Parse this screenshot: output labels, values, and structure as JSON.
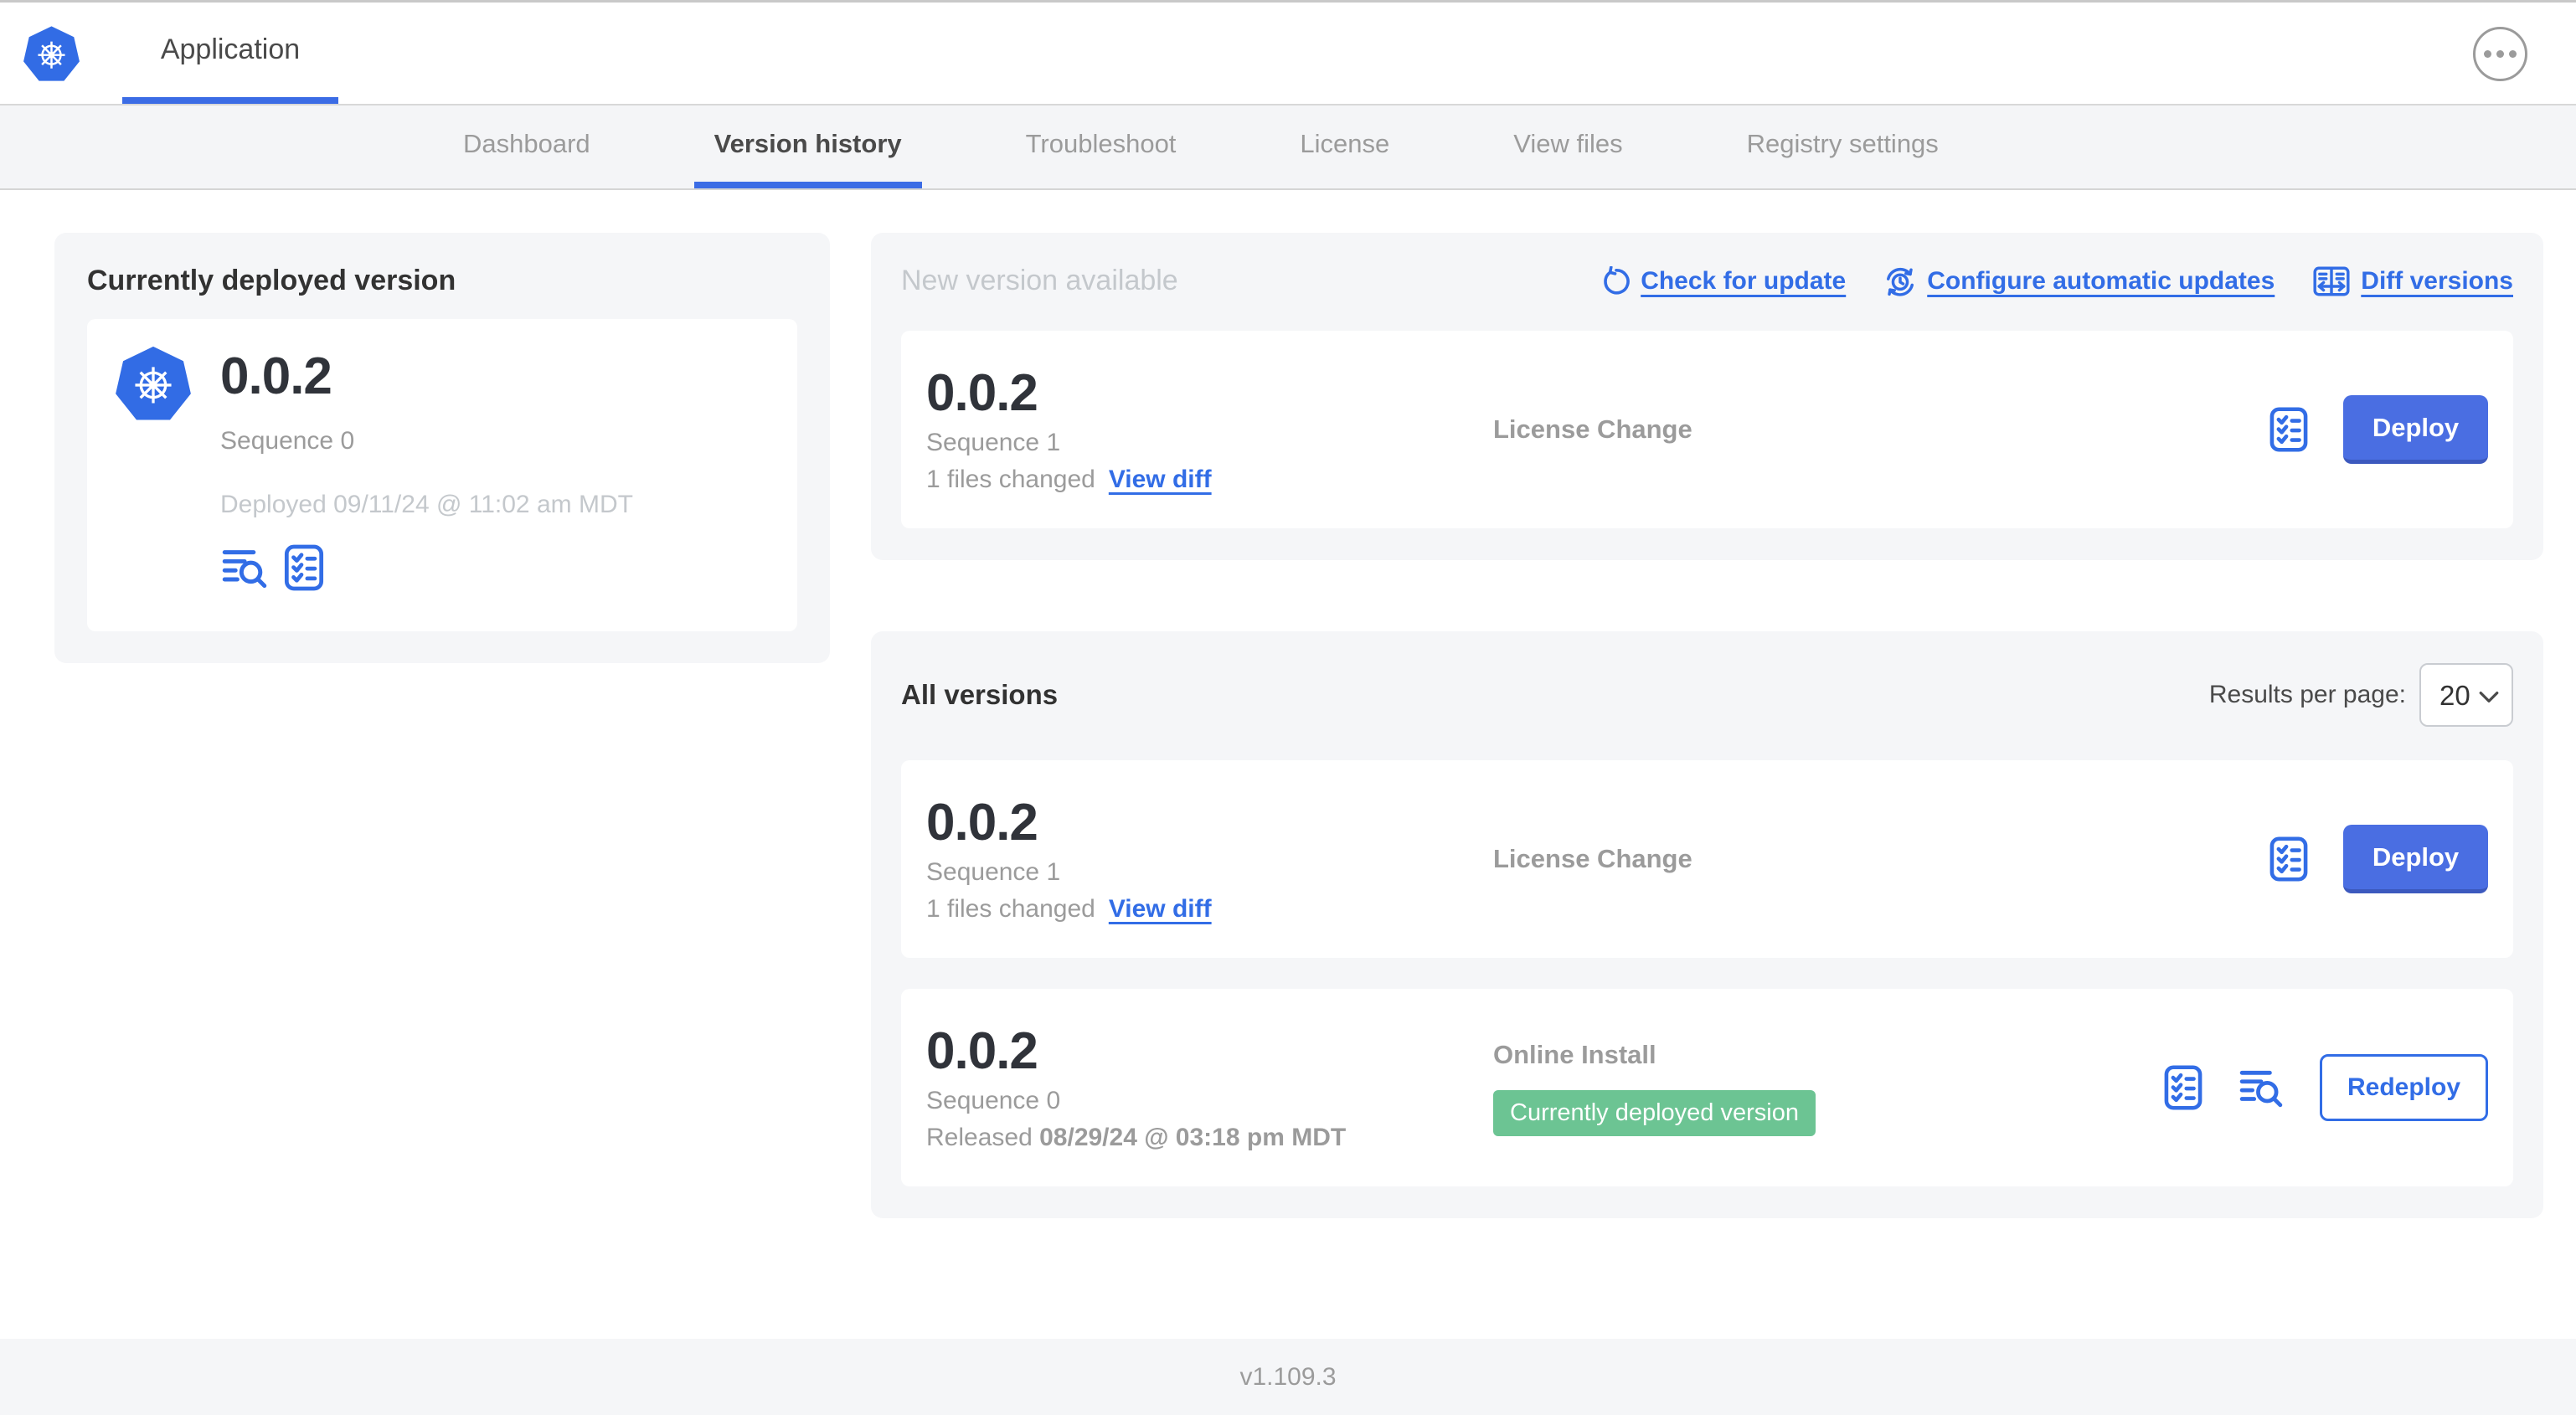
{
  "header": {
    "app_title": "Application",
    "more_icon": "ellipsis-menu-icon"
  },
  "nav": {
    "active_tab": "Version history",
    "tabs": [
      {
        "label": "Dashboard"
      },
      {
        "label": "Version history"
      },
      {
        "label": "Troubleshoot"
      },
      {
        "label": "License"
      },
      {
        "label": "View files"
      },
      {
        "label": "Registry settings"
      }
    ]
  },
  "current_deployed": {
    "title": "Currently deployed version",
    "version": "0.0.2",
    "sequence": "Sequence 0",
    "deployed": "Deployed 09/11/24 @ 11:02 am MDT",
    "icons": [
      "view-logs-icon",
      "preflight-checks-icon"
    ]
  },
  "new_version": {
    "title": "New version available",
    "check_for_update": "Check for update",
    "configure_updates": "Configure automatic updates",
    "diff_versions": "Diff versions",
    "card": {
      "version": "0.0.2",
      "sequence": "Sequence 1",
      "files_changed": "1 files changed",
      "view_diff": "View diff",
      "change_type": "License Change",
      "deploy_label": "Deploy"
    }
  },
  "all_versions": {
    "title": "All versions",
    "results_per_page_label": "Results per page:",
    "results_per_page_value": "20",
    "rows": [
      {
        "version": "0.0.2",
        "sequence": "Sequence 1",
        "files_changed": "1 files changed",
        "view_diff": "View diff",
        "change_type": "License Change",
        "action_label": "Deploy"
      },
      {
        "version": "0.0.2",
        "sequence": "Sequence 0",
        "released_prefix": "Released",
        "released_date": "08/29/24 @ 03:18 pm MDT",
        "install_type": "Online Install",
        "badge": "Currently deployed version",
        "action_label": "Redeploy"
      }
    ]
  },
  "footer": {
    "app_version": "v1.109.3"
  },
  "colors": {
    "accent_blue": "#326de6",
    "button_blue": "#4a6ee2",
    "badge_green": "#6cc493",
    "kube_blue": "#326ce5"
  }
}
